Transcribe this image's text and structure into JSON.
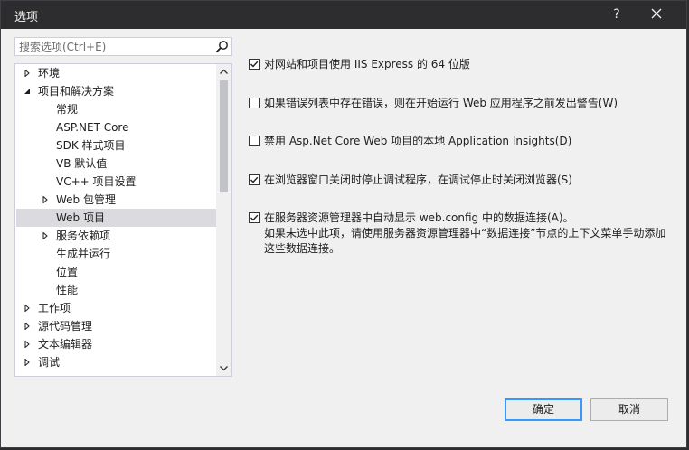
{
  "dialog": {
    "title": "选项",
    "help_label": "?"
  },
  "search": {
    "placeholder": "搜索选项(Ctrl+E)"
  },
  "tree": {
    "items": [
      {
        "label": "环境",
        "level": 0,
        "expander": "collapsed"
      },
      {
        "label": "项目和解决方案",
        "level": 0,
        "expander": "expanded"
      },
      {
        "label": "常规",
        "level": 1,
        "expander": "none"
      },
      {
        "label": "ASP.NET Core",
        "level": 1,
        "expander": "none"
      },
      {
        "label": "SDK 样式项目",
        "level": 1,
        "expander": "none"
      },
      {
        "label": "VB 默认值",
        "level": 1,
        "expander": "none"
      },
      {
        "label": "VC++ 项目设置",
        "level": 1,
        "expander": "none"
      },
      {
        "label": "Web 包管理",
        "level": 1,
        "expander": "collapsed"
      },
      {
        "label": "Web 项目",
        "level": 1,
        "expander": "none",
        "selected": true
      },
      {
        "label": "服务依赖项",
        "level": 1,
        "expander": "collapsed"
      },
      {
        "label": "生成并运行",
        "level": 1,
        "expander": "none"
      },
      {
        "label": "位置",
        "level": 1,
        "expander": "none"
      },
      {
        "label": "性能",
        "level": 1,
        "expander": "none"
      },
      {
        "label": "工作项",
        "level": 0,
        "expander": "collapsed"
      },
      {
        "label": "源代码管理",
        "level": 0,
        "expander": "collapsed"
      },
      {
        "label": "文本编辑器",
        "level": 0,
        "expander": "collapsed"
      },
      {
        "label": "调试",
        "level": 0,
        "expander": "collapsed"
      }
    ]
  },
  "options": [
    {
      "label": "对网站和项目使用 IIS Express 的 64 位版",
      "checked": true
    },
    {
      "label": "如果错误列表中存在错误，则在开始运行 Web 应用程序之前发出警告(W)",
      "checked": false
    },
    {
      "label": "禁用 Asp.Net Core Web 项目的本地 Application Insights(D)",
      "checked": false
    },
    {
      "label": "在浏览器窗口关闭时停止调试程序，在调试停止时关闭浏览器(S)",
      "checked": true
    },
    {
      "label": "在服务器资源管理器中自动显示 web.config 中的数据连接(A)。",
      "checked": true,
      "description": "如果未选中此项，请使用服务器资源管理器中“数据连接”节点的上下文菜单手动添加这些数据连接。"
    }
  ],
  "buttons": {
    "ok": "确定",
    "cancel": "取消"
  },
  "colors": {
    "selection": "#dadadf",
    "default_button_border": "#3399ff",
    "titlebar": "#2d2d30"
  }
}
